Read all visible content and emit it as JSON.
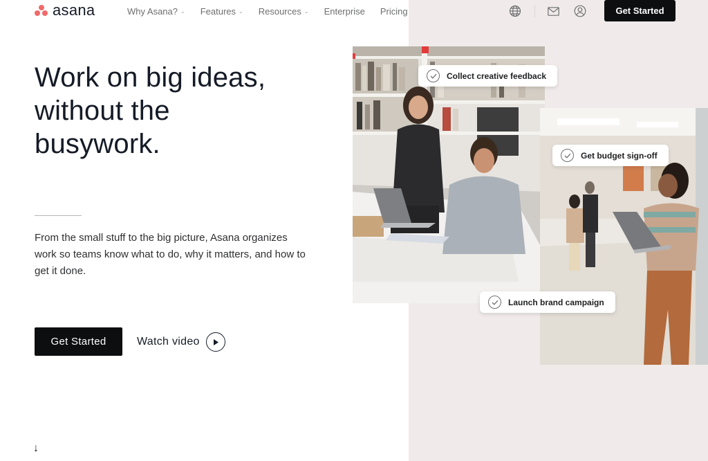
{
  "brand": {
    "name": "asana",
    "dot_color": "#f06a6a"
  },
  "nav": {
    "links": [
      {
        "label": "Why Asana?",
        "has_dropdown": true
      },
      {
        "label": "Features",
        "has_dropdown": true
      },
      {
        "label": "Resources",
        "has_dropdown": true
      },
      {
        "label": "Enterprise",
        "has_dropdown": false
      },
      {
        "label": "Pricing",
        "has_dropdown": false
      }
    ],
    "icons": [
      "globe-icon",
      "mail-icon",
      "account-icon"
    ],
    "cta_label": "Get Started"
  },
  "hero": {
    "headline": [
      "Work on big ideas,",
      "without the",
      "busywork."
    ],
    "subtext": "From the small stuff to the big picture, Asana organizes work so teams know what to do, why it matters, and how to get it done.",
    "primary_cta": "Get Started",
    "secondary_cta": "Watch video",
    "scroll_arrow": "↓"
  },
  "tags": [
    {
      "label": "Collect creative feedback"
    },
    {
      "label": "Get budget sign-off"
    },
    {
      "label": "Launch brand campaign"
    }
  ],
  "colors": {
    "panel_bg": "#f0ebea",
    "button_dark": "#0d0e10",
    "text_primary": "#151b26"
  }
}
